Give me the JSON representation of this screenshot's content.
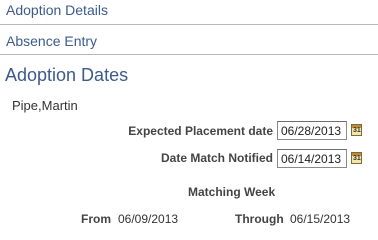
{
  "nav": {
    "adoption_details": "Adoption Details",
    "absence_entry": "Absence Entry"
  },
  "section": {
    "title": "Adoption Dates"
  },
  "employee": {
    "name": "Pipe,Martin"
  },
  "fields": {
    "expected_placement": {
      "label": "Expected Placement date",
      "value": "06/28/2013"
    },
    "date_match_notified": {
      "label": "Date Match Notified",
      "value": "06/14/2013"
    }
  },
  "matching_week": {
    "title": "Matching Week",
    "from_label": "From",
    "from_value": "06/09/2013",
    "through_label": "Through",
    "through_value": "06/15/2013"
  },
  "icons": {
    "calendar": "calendar-icon",
    "calendar_glyph": "31"
  },
  "colors": {
    "link": "#3c5a8c",
    "title": "#3c5a8c",
    "separator": "#b8b8b8"
  }
}
